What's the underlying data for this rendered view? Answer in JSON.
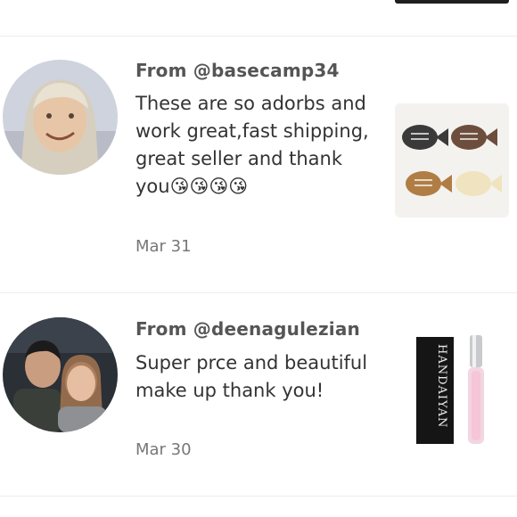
{
  "reviews": [
    {
      "from": "From @basecamp34",
      "comment": "These are so adorbs and work great,fast shipping, great seller and thank you",
      "emoji": "😘😘😘😘",
      "date": "Mar 31",
      "avatar_icon": "user-avatar-photo",
      "thumb_icon": "fish-clip-product-photo"
    },
    {
      "from": "From @deenagulezian",
      "comment": "Super prce and beautiful make up thank you!",
      "date": "Mar 30",
      "avatar_icon": "user-avatar-photo",
      "thumb_icon": "lip-gloss-product-photo",
      "thumb_brand": "HANDAIYAN"
    }
  ]
}
